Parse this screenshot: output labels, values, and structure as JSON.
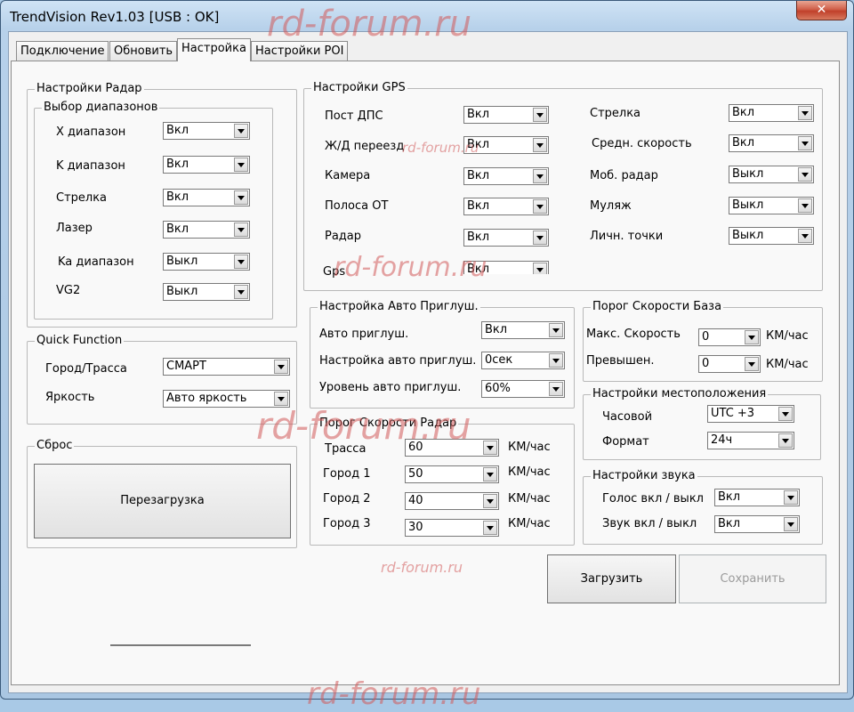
{
  "window": {
    "title": "TrendVision Rev1.03 [USB : OK]",
    "close": "✕"
  },
  "tabs": [
    "Подключение",
    "Обновить",
    "Настройка",
    "Настройки POI"
  ],
  "radar": {
    "title": "Настройки Радар",
    "bands_title": "Выбор диапазонов",
    "items": [
      {
        "label": "X диапазон",
        "value": "Вкл"
      },
      {
        "label": "K диапазон",
        "value": "Вкл"
      },
      {
        "label": "Стрелка",
        "value": "Вкл"
      },
      {
        "label": "Лазер",
        "value": "Вкл"
      },
      {
        "label": "Ka диапазон",
        "value": "Выкл"
      },
      {
        "label": "VG2",
        "value": "Выкл"
      }
    ]
  },
  "quick": {
    "title": "Quick Function",
    "items": [
      {
        "label": "Город/Трасса",
        "value": "СМАРТ"
      },
      {
        "label": "Яркость",
        "value": "Авто яркость"
      }
    ]
  },
  "reset": {
    "title": "Сброс",
    "button": "Перезагрузка"
  },
  "gps": {
    "title": "Настройки GPS",
    "left": [
      {
        "label": "Пост ДПС",
        "value": "Вкл"
      },
      {
        "label": "Ж/Д переезд",
        "value": "Вкл"
      },
      {
        "label": "Камера",
        "value": "Вкл"
      },
      {
        "label": "Полоса ОТ",
        "value": "Вкл"
      },
      {
        "label": "Радар",
        "value": "Вкл"
      },
      {
        "label": "Gps",
        "value": "Вкл"
      }
    ],
    "right": [
      {
        "label": "Стрелка",
        "value": "Вкл"
      },
      {
        "label": "Средн. скорость",
        "value": "Вкл"
      },
      {
        "label": "Моб. радар",
        "value": "Выкл"
      },
      {
        "label": "Муляж",
        "value": "Выкл"
      },
      {
        "label": "Личн. точки",
        "value": "Выкл"
      }
    ]
  },
  "automute": {
    "title": "Настройка Авто Приглуш.",
    "items": [
      {
        "label": "Авто приглуш.",
        "value": "Вкл"
      },
      {
        "label": "Настройка авто приглуш.",
        "value": "0сек"
      },
      {
        "label": "Уровень авто приглуш.",
        "value": "60%"
      }
    ]
  },
  "speedbase": {
    "title": "Порог Скорости База",
    "items": [
      {
        "label": "Макс. Скорость",
        "value": "0",
        "unit": "КМ/час"
      },
      {
        "label": "Превышен.",
        "value": "0",
        "unit": "КМ/час"
      }
    ]
  },
  "location": {
    "title": "Настройки местоположения",
    "items": [
      {
        "label": "Часовой",
        "value": "UTC +3"
      },
      {
        "label": "Формат",
        "value": "24ч"
      }
    ]
  },
  "speedradar": {
    "title": "Порог Скорости Радар",
    "items": [
      {
        "label": "Трасса",
        "value": "60",
        "unit": "КМ/час"
      },
      {
        "label": "Город 1",
        "value": "50",
        "unit": "КМ/час"
      },
      {
        "label": "Город 2",
        "value": "40",
        "unit": "КМ/час"
      },
      {
        "label": "Город 3",
        "value": "30",
        "unit": "КМ/час"
      }
    ]
  },
  "sound": {
    "title": "Настройки звука",
    "items": [
      {
        "label": "Голос вкл / выкл",
        "value": "Вкл"
      },
      {
        "label": "Звук вкл / выкл",
        "value": "Вкл"
      }
    ]
  },
  "actions": {
    "load": "Загрузить",
    "save": "Сохранить"
  },
  "watermarks": [
    "rd-forum.ru",
    "rd-forum.ru",
    "rd-forum.ru",
    "rd-forum.ru",
    "rd-forum.ru",
    "rd-forum.ru"
  ]
}
